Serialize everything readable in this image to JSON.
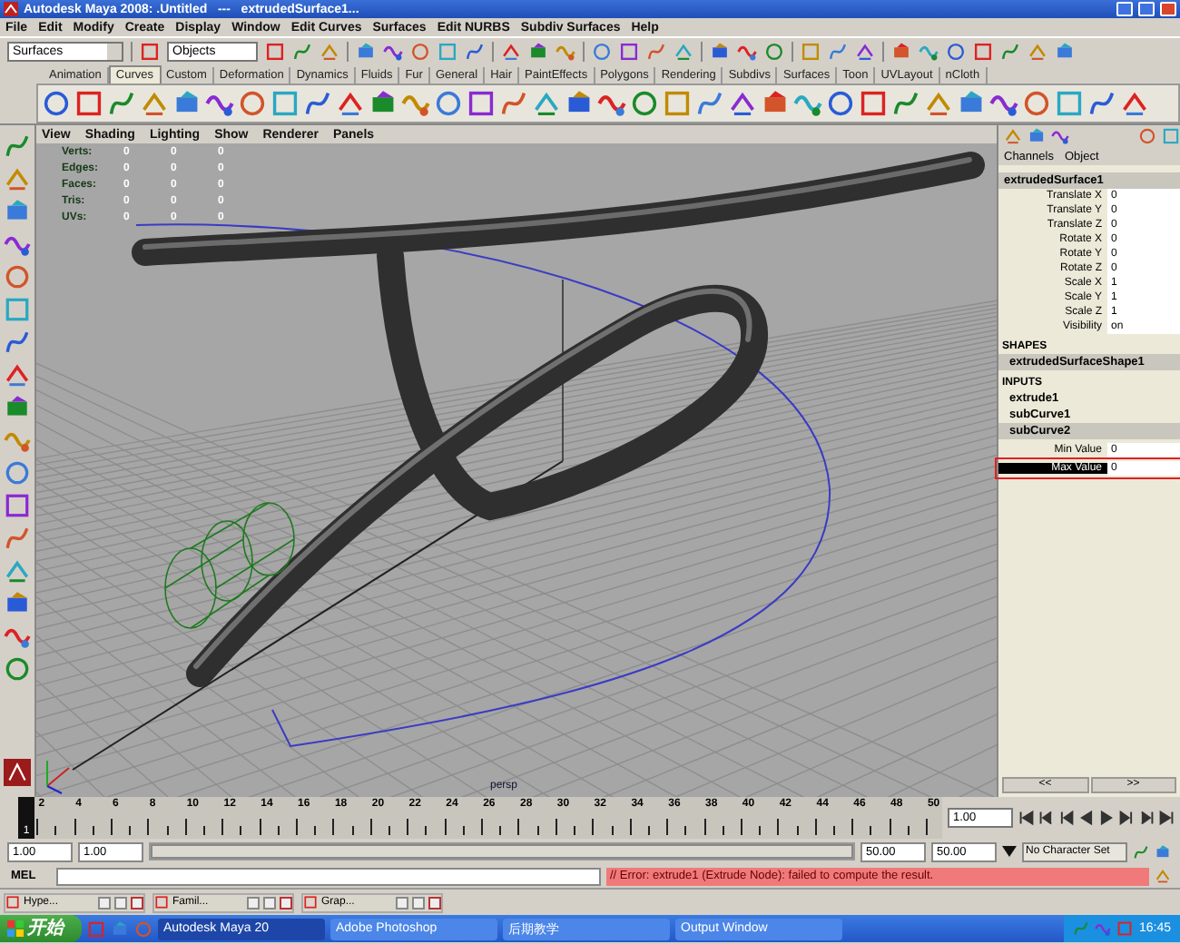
{
  "window": {
    "title": "Autodesk Maya 2008: .Untitled   ---   extrudedSurface1..."
  },
  "menu": [
    "File",
    "Edit",
    "Modify",
    "Create",
    "Display",
    "Window",
    "Edit Curves",
    "Surfaces",
    "Edit NURBS",
    "Subdiv Surfaces",
    "Help"
  ],
  "status_line": {
    "menu_set": "Surfaces",
    "selection_field": "Objects"
  },
  "shelf": {
    "tabs": [
      {
        "label": "Animation",
        "selected": false
      },
      {
        "label": "Curves",
        "selected": true
      },
      {
        "label": "Custom",
        "selected": false
      },
      {
        "label": "Deformation",
        "selected": false
      },
      {
        "label": "Dynamics",
        "selected": false
      },
      {
        "label": "Fluids",
        "selected": false
      },
      {
        "label": "Fur",
        "selected": false
      },
      {
        "label": "General",
        "selected": false
      },
      {
        "label": "Hair",
        "selected": false
      },
      {
        "label": "PaintEffects",
        "selected": false
      },
      {
        "label": "Polygons",
        "selected": false
      },
      {
        "label": "Rendering",
        "selected": false
      },
      {
        "label": "Subdivs",
        "selected": false
      },
      {
        "label": "Surfaces",
        "selected": false
      },
      {
        "label": "Toon",
        "selected": false
      },
      {
        "label": "UVLayout",
        "selected": false
      },
      {
        "label": "nCloth",
        "selected": false
      }
    ]
  },
  "viewport": {
    "menu": [
      "View",
      "Shading",
      "Lighting",
      "Show",
      "Renderer",
      "Panels"
    ],
    "hud": [
      {
        "label": "Verts:",
        "values": [
          "0",
          "0",
          "0"
        ]
      },
      {
        "label": "Edges:",
        "values": [
          "0",
          "0",
          "0"
        ]
      },
      {
        "label": "Faces:",
        "values": [
          "0",
          "0",
          "0"
        ]
      },
      {
        "label": "Tris:",
        "values": [
          "0",
          "0",
          "0"
        ]
      },
      {
        "label": "UVs:",
        "values": [
          "0",
          "0",
          "0"
        ]
      }
    ],
    "camera": "persp"
  },
  "channel_box": {
    "tabs": [
      "Channels",
      "Object"
    ],
    "node": "extrudedSurface1",
    "attributes": [
      {
        "name": "Translate X",
        "value": "0"
      },
      {
        "name": "Translate Y",
        "value": "0"
      },
      {
        "name": "Translate Z",
        "value": "0"
      },
      {
        "name": "Rotate X",
        "value": "0"
      },
      {
        "name": "Rotate Y",
        "value": "0"
      },
      {
        "name": "Rotate Z",
        "value": "0"
      },
      {
        "name": "Scale X",
        "value": "1"
      },
      {
        "name": "Scale Y",
        "value": "1"
      },
      {
        "name": "Scale Z",
        "value": "1"
      },
      {
        "name": "Visibility",
        "value": "on"
      }
    ],
    "shapes_heading": "SHAPES",
    "shape": "extrudedSurfaceShape1",
    "inputs_heading": "INPUTS",
    "inputs": [
      {
        "label": "extrude1",
        "selected": false
      },
      {
        "label": "subCurve1",
        "selected": false
      },
      {
        "label": "subCurve2",
        "selected": true
      }
    ],
    "input_attributes": [
      {
        "name": "Min Value",
        "value": "0",
        "selected": false,
        "highlighted": false
      },
      {
        "name": "Max Value",
        "value": "0",
        "selected": true,
        "highlighted": true
      }
    ],
    "page_buttons": [
      "<<",
      ">>"
    ]
  },
  "timeline": {
    "current_frame": "1",
    "frame_labels": [
      "2",
      "4",
      "6",
      "8",
      "10",
      "12",
      "14",
      "16",
      "18",
      "20",
      "22",
      "24",
      "26",
      "28",
      "30",
      "32",
      "34",
      "36",
      "38",
      "40",
      "42",
      "44",
      "46",
      "48",
      "50"
    ],
    "current_time": "1.00"
  },
  "range": {
    "level": 1,
    "start": "1.00",
    "playback_start": "1.00",
    "playback_end": "50.00",
    "end": "50.00",
    "character_set": "No Character Set"
  },
  "command_line": {
    "label": "MEL",
    "result": "// Error: extrude1 (Extrude Node): failed to compute the result."
  },
  "minimized_windows": [
    "Hype...",
    "Famil...",
    "Grap..."
  ],
  "taskbar": {
    "start": "开始",
    "tasks": [
      {
        "label": "Autodesk Maya 20",
        "selected": true
      },
      {
        "label": "Adobe Photoshop",
        "selected": false
      },
      {
        "label": "后期教学",
        "selected": false
      },
      {
        "label": "Output Window",
        "selected": false
      }
    ],
    "clock": "16:45"
  }
}
